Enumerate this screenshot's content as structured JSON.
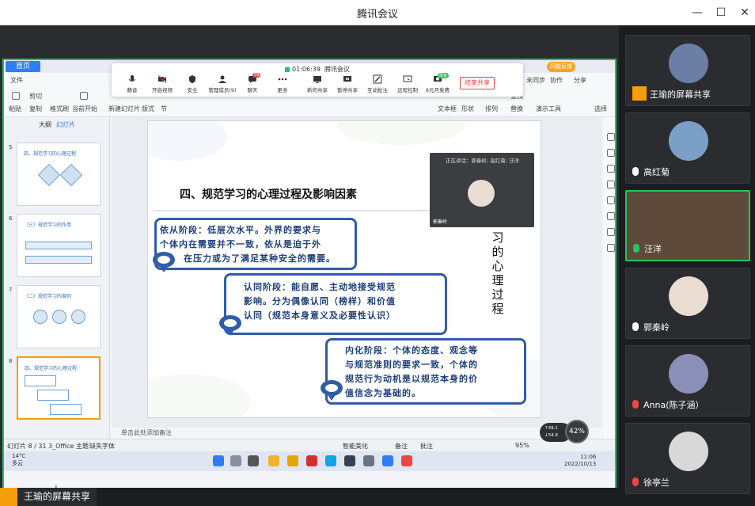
{
  "window": {
    "title": "腾讯会议",
    "minimize": "—",
    "maximize": "☐",
    "close": "✕"
  },
  "meeting_toolbar": {
    "elapsed": "01:06:39",
    "app_name": "腾讯会议",
    "tools": [
      {
        "label": "静音"
      },
      {
        "label": "开启视频"
      },
      {
        "label": "安全"
      },
      {
        "label": "管理成员(9)"
      },
      {
        "label": "聊天"
      },
      {
        "label": "更多"
      },
      {
        "label": "新的共享"
      },
      {
        "label": "暂停共享"
      },
      {
        "label": "互动批注"
      },
      {
        "label": "远程控制"
      },
      {
        "label": "6元月免费"
      }
    ],
    "chat_badge": "99",
    "remote_badge": "限免",
    "end_share": "结束共享",
    "feedback": "问题反馈"
  },
  "wps": {
    "home_tab": "首页",
    "ribbon_left": [
      "文件",
      "粘贴",
      "剪切",
      "复制",
      "格式刷",
      "当前开始",
      "新建幻灯片",
      "版式",
      "节"
    ],
    "ribbon_right": [
      "未同步",
      "协作",
      "分享",
      "文本框",
      "形状",
      "排列",
      "查找",
      "替换",
      "演示工具",
      "选择"
    ],
    "left_tabs": {
      "outline": "大纲",
      "slides": "幻灯片"
    },
    "thumbnails": [
      {
        "num": "5",
        "title": "四、规范学习的心理过程"
      },
      {
        "num": "6",
        "title": "（三）规范学习的作用"
      },
      {
        "num": "7",
        "title": "（二）规范学习的准则"
      },
      {
        "num": "8",
        "title": "四、规范学习的心理过程"
      }
    ],
    "add_slide": "+",
    "notes_placeholder": "单击此处添加备注",
    "status": {
      "slide_pos": "幻灯片 8 / 31",
      "theme": "3_Office 主题",
      "font_missing": "缺失字体",
      "beautify": "智能美化",
      "notes": "备注",
      "comments": "批注",
      "zoom": "95%"
    }
  },
  "slide": {
    "title": "四、规范学习的心理过程及影响因素",
    "bubble1": [
      "依从阶段：低层次水平。外界的要求与",
      "个体内在需要并不一致，依从是迫于外",
      "在压力或为了满足某种安全的需要。"
    ],
    "bubble2": [
      "认同阶段：能自愿、主动地接受规范",
      "影响。分为偶像认同（榜样）和价值",
      "认同（规范本身意义及必要性认识）"
    ],
    "bubble3": [
      "内化阶段：个体的态度、观念等",
      "与规范准则的要求一致，个体的",
      "规范行为动机是以规范本身的价",
      "值信念为基础的。"
    ],
    "side_text": [
      "习",
      "的",
      "心",
      "理",
      "过",
      "程"
    ]
  },
  "speaker_popup": {
    "header": "正在讲话：郭秦岭; 高红菊; 汪洋",
    "name": "郭秦岭"
  },
  "taskbar": {
    "temp": "14°C",
    "weather": "多云",
    "time": "11:06",
    "date": "2022/10/13"
  },
  "network": {
    "up": "↑49.1",
    "down": "↓54.9",
    "cpu_pct": "42%"
  },
  "sharer": {
    "label": "王瑜的屏幕共享"
  },
  "participants": [
    {
      "name": "王瑜的屏幕共享",
      "mic": "share",
      "avatar": "#6b7fa6"
    },
    {
      "name": "高红菊",
      "mic": "on",
      "avatar": "#7aa0c8"
    },
    {
      "name": "汪洋",
      "mic": "speaking",
      "avatar": "#5d4a3a"
    },
    {
      "name": "郭秦岭",
      "mic": "on",
      "avatar": "#e8dcd3"
    },
    {
      "name": "Anna(陈子涵）",
      "mic": "muted",
      "avatar": "#8a8fb8"
    },
    {
      "name": "徐亭兰",
      "mic": "muted",
      "avatar": "#d8d8d8"
    }
  ]
}
